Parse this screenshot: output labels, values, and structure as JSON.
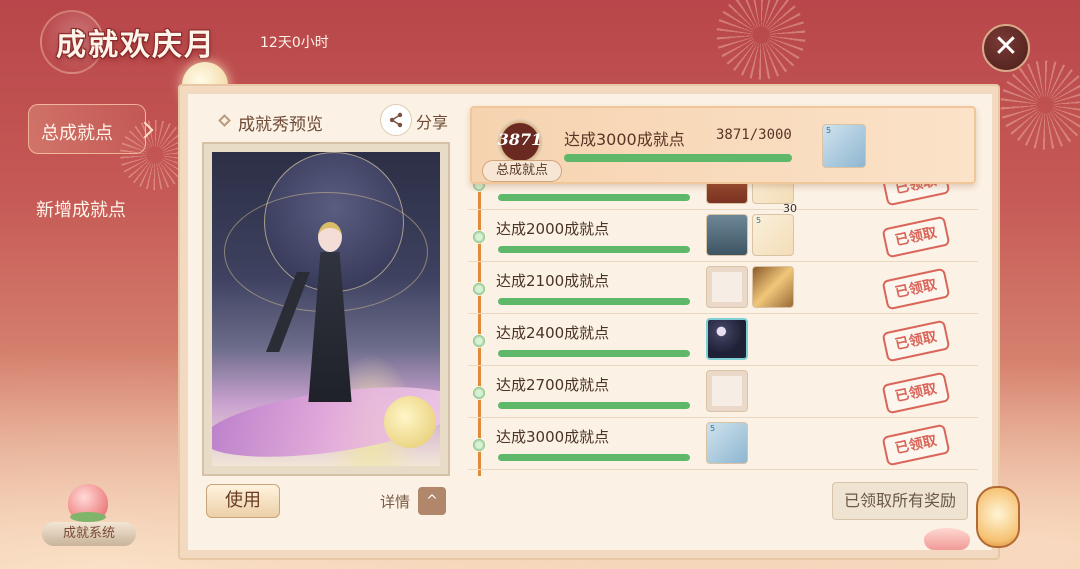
{
  "header": {
    "title": "成就欢庆月",
    "timer": "12天0小时",
    "close_icon": "✕"
  },
  "nav": {
    "items": [
      {
        "label": "总成就点",
        "active": true
      },
      {
        "label": "新增成就点",
        "active": false
      }
    ],
    "system_label": "成就系统"
  },
  "preview": {
    "title": "成就秀预览",
    "share_label": "分享",
    "share_icon": "share-icon",
    "use_label": "使用",
    "detail_label": "详情",
    "detail_icon": "^"
  },
  "summary": {
    "points": "3871",
    "points_label": "总成就点",
    "title": "达成3000成就点",
    "progress_text": "3871/3000",
    "progress": 1.0,
    "reward_tag": "5"
  },
  "rows": [
    {
      "label": "",
      "progress": 1.0,
      "claimed_label": "已领取",
      "rewards": [
        "sunset",
        "cream"
      ],
      "reward_count": "30"
    },
    {
      "label": "达成2000成就点",
      "progress": 1.0,
      "claimed_label": "已领取",
      "rewards": [
        "water",
        "cream"
      ]
    },
    {
      "label": "达成2100成就点",
      "progress": 1.0,
      "claimed_label": "已领取",
      "rewards": [
        "frame",
        "gold"
      ]
    },
    {
      "label": "达成2400成就点",
      "progress": 1.0,
      "claimed_label": "已领取",
      "rewards": [
        "night"
      ]
    },
    {
      "label": "达成2700成就点",
      "progress": 1.0,
      "claimed_label": "已领取",
      "rewards": [
        "frame"
      ]
    },
    {
      "label": "达成3000成就点",
      "progress": 1.0,
      "claimed_label": "已领取",
      "rewards": [
        "blue"
      ]
    }
  ],
  "reward_small_tag": "5",
  "claim_all_label": "已领取所有奖励",
  "colors": {
    "progress_green": "#5fb86a",
    "stamp_red": "#d9665a",
    "timeline_orange": "#e08a3a",
    "bg_red": "#b8464a"
  }
}
